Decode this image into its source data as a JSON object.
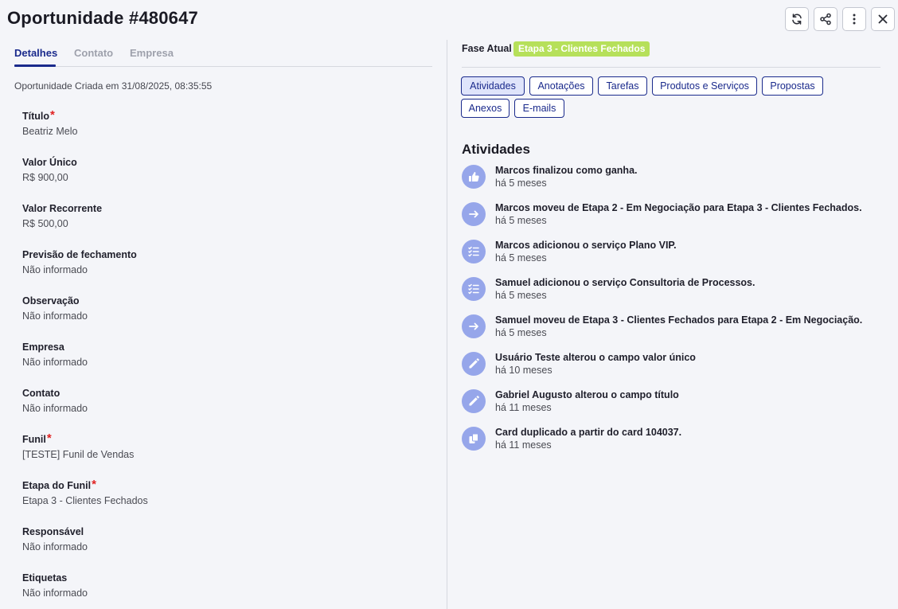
{
  "header": {
    "title": "Oportunidade #480647",
    "actions": [
      {
        "name": "refresh-icon"
      },
      {
        "name": "share-icon"
      },
      {
        "name": "more-vertical-icon"
      },
      {
        "name": "close-icon"
      }
    ]
  },
  "tabs": [
    {
      "label": "Detalhes",
      "active": true
    },
    {
      "label": "Contato",
      "active": false
    },
    {
      "label": "Empresa",
      "active": false
    }
  ],
  "created_text": "Oportunidade Criada em 31/08/2025, 08:35:55",
  "fields": [
    {
      "label": "Título",
      "required": true,
      "value": "Beatriz Melo"
    },
    {
      "label": "Valor Único",
      "required": false,
      "value": "R$ 900,00"
    },
    {
      "label": "Valor Recorrente",
      "required": false,
      "value": "R$ 500,00"
    },
    {
      "label": "Previsão de fechamento",
      "required": false,
      "value": "Não informado"
    },
    {
      "label": "Observação",
      "required": false,
      "value": "Não informado"
    },
    {
      "label": "Empresa",
      "required": false,
      "value": "Não informado"
    },
    {
      "label": "Contato",
      "required": false,
      "value": "Não informado"
    },
    {
      "label": "Funil",
      "required": true,
      "value": "[TESTE] Funil de Vendas"
    },
    {
      "label": "Etapa do Funil",
      "required": true,
      "value": "Etapa 3 - Clientes Fechados"
    },
    {
      "label": "Responsável",
      "required": false,
      "value": "Não informado"
    },
    {
      "label": "Etiquetas",
      "required": false,
      "value": "Não informado"
    }
  ],
  "required_mark": "*",
  "phase": {
    "label": "Fase Atual",
    "value": "Etapa 3 - Clientes Fechados",
    "color": "#b6e05a"
  },
  "pills": [
    {
      "label": "Atividades",
      "active": true
    },
    {
      "label": "Anotações",
      "active": false
    },
    {
      "label": "Tarefas",
      "active": false
    },
    {
      "label": "Produtos e Serviços",
      "active": false
    },
    {
      "label": "Propostas",
      "active": false
    },
    {
      "label": "Anexos",
      "active": false
    },
    {
      "label": "E-mails",
      "active": false
    }
  ],
  "activities_title": "Atividades",
  "activities": [
    {
      "icon": "thumbs-up-icon",
      "text": "Marcos finalizou como ganha.",
      "time": "há 5 meses"
    },
    {
      "icon": "arrow-right-icon",
      "text": "Marcos moveu de Etapa 2 - Em Negociação para Etapa 3 - Clientes Fechados.",
      "time": "há 5 meses"
    },
    {
      "icon": "checklist-icon",
      "text": "Marcos adicionou o serviço Plano VIP.",
      "time": "há 5 meses"
    },
    {
      "icon": "checklist-icon",
      "text": "Samuel adicionou o serviço Consultoria de Processos.",
      "time": "há 5 meses"
    },
    {
      "icon": "arrow-right-icon",
      "text": "Samuel moveu de Etapa 3 - Clientes Fechados para Etapa 2 - Em Negociação.",
      "time": "há 5 meses"
    },
    {
      "icon": "pencil-icon",
      "text": "Usuário Teste alterou o campo valor único",
      "time": "há 10 meses"
    },
    {
      "icon": "pencil-icon",
      "text": "Gabriel Augusto alterou o campo título",
      "time": "há 11 meses"
    },
    {
      "icon": "copy-icon",
      "text": "Card duplicado a partir do card 104037.",
      "time": "há 11 meses"
    }
  ],
  "colors": {
    "accent": "#1a2a8c",
    "activity_icon_bg": "#96a6ea",
    "required": "#e02222"
  }
}
